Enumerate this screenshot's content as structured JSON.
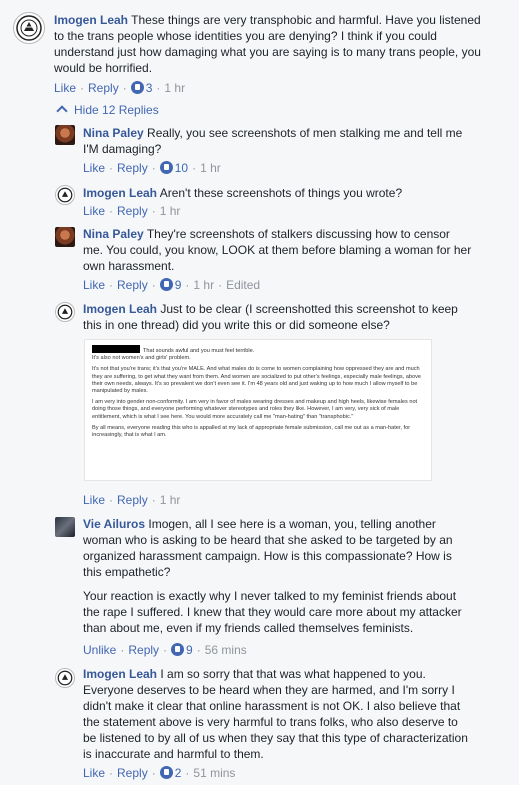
{
  "comments": [
    {
      "author": "Imogen Leah",
      "text": "These things are very transphobic and harmful. Have you listened",
      "lines": [
        "to the trans people whose identities you are denying? I think if you could",
        "understand just how damaging what you are saying is to many trans people, you",
        "would be horrified."
      ],
      "like": "Like",
      "reply": "Reply",
      "likes": "3",
      "time": "1 hr"
    }
  ],
  "hide_replies_label": "Hide 12 Replies",
  "replies": [
    {
      "author": "Nina Paley",
      "first": "Really, you see screenshots of men stalking me and tell me",
      "lines": [
        "I'M damaging?"
      ],
      "like": "Like",
      "reply": "Reply",
      "likes": "10",
      "time": "1 hr"
    },
    {
      "author": "Imogen Leah",
      "first": "Aren't these screenshots of things you wrote?",
      "lines": [],
      "like": "Like",
      "reply": "Reply",
      "time": "1 hr"
    },
    {
      "author": "Nina Paley",
      "first": "They're screenshots of stalkers discussing how to censor",
      "lines": [
        "me. You could, you know, LOOK at them before blaming a woman for her",
        "own harassment."
      ],
      "like": "Like",
      "reply": "Reply",
      "likes": "9",
      "time": "1 hr",
      "edited": "Edited"
    },
    {
      "author": "Imogen Leah",
      "first": "Just to be clear (I screenshotted this screenshot to keep",
      "lines": [
        "this in one thread) did you write this or did someone else?"
      ],
      "like": "Like",
      "reply": "Reply",
      "time": "1 hr"
    },
    {
      "author": "Vie Ailuros",
      "first": "Imogen, all I see here is a woman, you, telling another",
      "lines": [
        "woman who is asking to be heard that she asked to be targeted by an",
        "organized harassment campaign. How is this compassionate? How is",
        "this empathetic?",
        "",
        "Your reaction is exactly why I never talked to my feminist friends about",
        "the rape I suffered. I knew that they would care more about my attacker",
        "than about me, even if my friends called themselves feminists."
      ],
      "like": "Unlike",
      "reply": "Reply",
      "likes": "9",
      "time": "56 mins"
    },
    {
      "author": "Imogen Leah",
      "first": "I am so sorry that that was what happened to you.",
      "lines": [
        "Everyone deserves to be heard when they are harmed, and I'm sorry I",
        "didn't make it clear that online harassment is not OK. I also believe that",
        "the statement above is very harmful to trans folks, who also deserve to",
        "be listened to by all of us when they say that this type of characterization",
        "is inaccurate and harmful to them."
      ],
      "like": "Like",
      "reply": "Reply",
      "likes": "2",
      "time": "51 mins"
    }
  ],
  "screenshot": {
    "p1a": "That sounds awful and you must feel terrible.",
    "p1b": "It's also not women's and girls' problem.",
    "p2": "It's not that you're trans; it's that you're MALE. And what males do is come to women complaining how oppressed they are and much they are suffering, to get what they want from them. And women are socialized to put other's feelings, especially male feelings, above their own needs, always. It's so prevalent we don't even see it. I'm 48 years old and just waking up to how much I allow myself to be manipulated by males.",
    "p3": "I am very into gender non-conformity. I am very in favor of males wearing dresses and makeup and high heels, likewise females not doing those things, and everyone performing whatever stereotypes and roles they like. However, I am very, very sick of male entitlement, which is what I see here. You would more accurately call me \"man-hating\" than \"transphobic.\"",
    "p4": "By all means, everyone reading this who is appalled at my lack of appropriate female submission, call me out as a man-hater, for increasingly, that is what I am."
  }
}
